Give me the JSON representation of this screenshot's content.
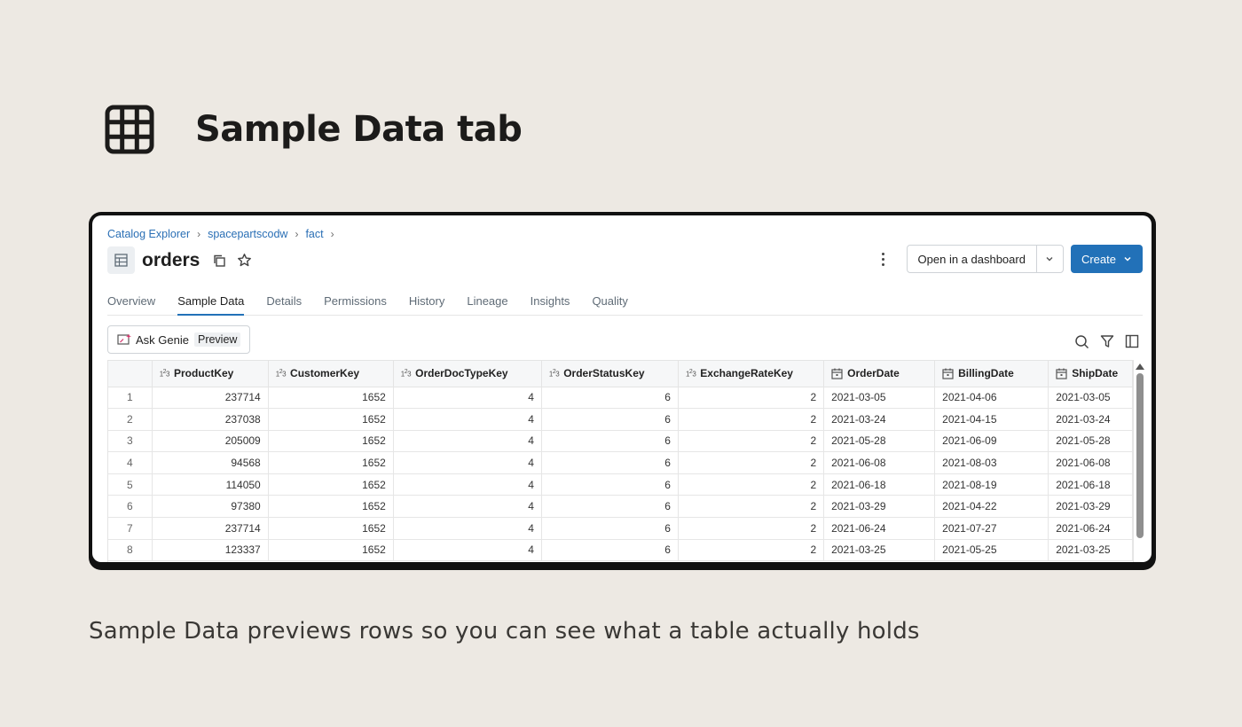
{
  "slide": {
    "title": "Sample Data tab",
    "caption": "Sample Data previews rows so you can see what a table actually holds"
  },
  "breadcrumb": [
    "Catalog Explorer",
    "spacepartscodw",
    "fact"
  ],
  "table_name": "orders",
  "actions": {
    "open_dashboard": "Open in a dashboard",
    "create": "Create"
  },
  "tabs": [
    {
      "label": "Overview",
      "active": false
    },
    {
      "label": "Sample Data",
      "active": true
    },
    {
      "label": "Details",
      "active": false
    },
    {
      "label": "Permissions",
      "active": false
    },
    {
      "label": "History",
      "active": false
    },
    {
      "label": "Lineage",
      "active": false
    },
    {
      "label": "Insights",
      "active": false
    },
    {
      "label": "Quality",
      "active": false
    }
  ],
  "ask_genie": {
    "label": "Ask Genie",
    "tag": "Preview"
  },
  "grid": {
    "columns": [
      {
        "name": "ProductKey",
        "type": "numeric"
      },
      {
        "name": "CustomerKey",
        "type": "numeric"
      },
      {
        "name": "OrderDocTypeKey",
        "type": "numeric"
      },
      {
        "name": "OrderStatusKey",
        "type": "numeric"
      },
      {
        "name": "ExchangeRateKey",
        "type": "numeric"
      },
      {
        "name": "OrderDate",
        "type": "date"
      },
      {
        "name": "BillingDate",
        "type": "date"
      },
      {
        "name": "ShipDate",
        "type": "date"
      }
    ],
    "rows": [
      [
        "1",
        "237714",
        "1652",
        "4",
        "6",
        "2",
        "2021-03-05",
        "2021-04-06",
        "2021-03-05"
      ],
      [
        "2",
        "237038",
        "1652",
        "4",
        "6",
        "2",
        "2021-03-24",
        "2021-04-15",
        "2021-03-24"
      ],
      [
        "3",
        "205009",
        "1652",
        "4",
        "6",
        "2",
        "2021-05-28",
        "2021-06-09",
        "2021-05-28"
      ],
      [
        "4",
        "94568",
        "1652",
        "4",
        "6",
        "2",
        "2021-06-08",
        "2021-08-03",
        "2021-06-08"
      ],
      [
        "5",
        "114050",
        "1652",
        "4",
        "6",
        "2",
        "2021-06-18",
        "2021-08-19",
        "2021-06-18"
      ],
      [
        "6",
        "97380",
        "1652",
        "4",
        "6",
        "2",
        "2021-03-29",
        "2021-04-22",
        "2021-03-29"
      ],
      [
        "7",
        "237714",
        "1652",
        "4",
        "6",
        "2",
        "2021-06-24",
        "2021-07-27",
        "2021-06-24"
      ],
      [
        "8",
        "123337",
        "1652",
        "4",
        "6",
        "2",
        "2021-03-25",
        "2021-05-25",
        "2021-03-25"
      ]
    ]
  },
  "colors": {
    "background": "#ede9e3",
    "link": "#2a6fb5",
    "primary_button": "#2271b8",
    "genie_accent": "#d6336c"
  }
}
